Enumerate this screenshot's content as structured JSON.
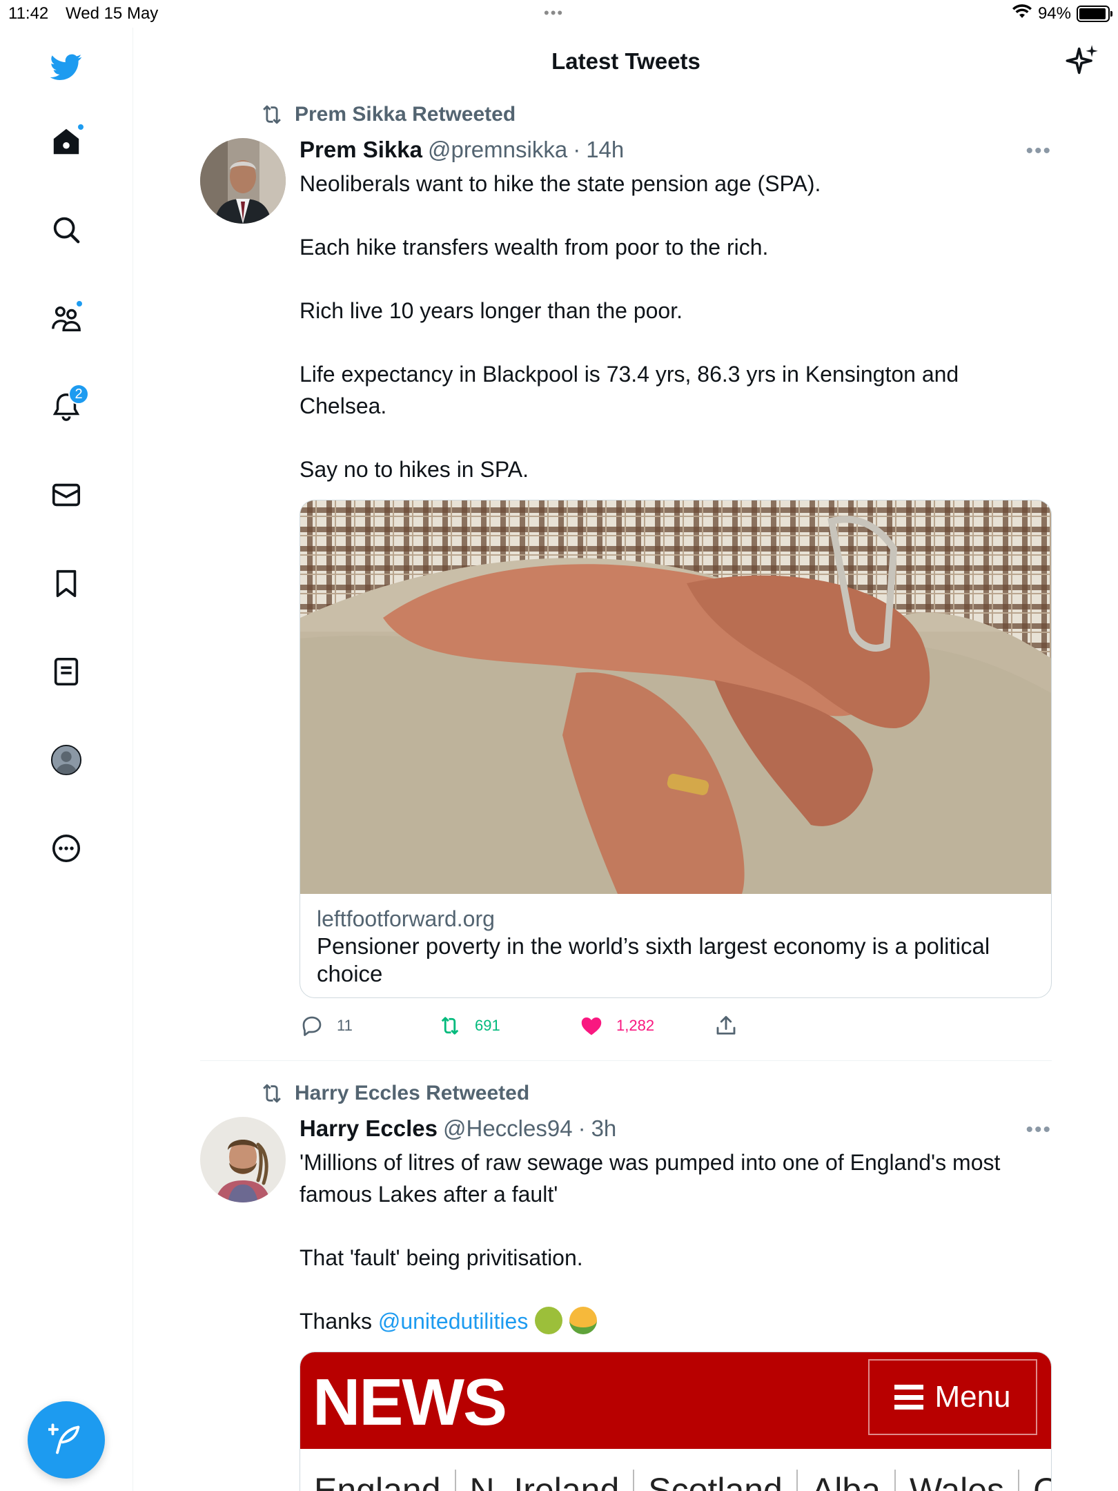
{
  "status_bar": {
    "time": "11:42",
    "date": "Wed 15 May",
    "dots": "•••",
    "battery": "94%",
    "battery_level": 0.94
  },
  "header": {
    "title": "Latest Tweets"
  },
  "sidebar": {
    "notifications_badge": "2",
    "items": [
      "twitter-logo",
      "home-icon",
      "search-icon",
      "communities-icon",
      "notifications-icon",
      "messages-icon",
      "bookmarks-icon",
      "lists-icon",
      "profile-icon",
      "more-icon"
    ]
  },
  "tweets": [
    {
      "retweeted_by": "Prem Sikka Retweeted",
      "author": "Prem Sikka",
      "handle": "@premnsikka",
      "sep": "·",
      "time": "14h",
      "more": "•••",
      "lines": [
        "Neoliberals want to hike the state pension age (SPA).",
        "",
        "Each hike transfers wealth from poor to the rich.",
        "",
        "Rich live 10 years longer than the poor.",
        "",
        "Life expectancy in Blackpool is 73.4 yrs,  86.3 yrs in Kensington and Chelsea.",
        "",
        "Say no to hikes in SPA."
      ],
      "card": {
        "domain": "leftfootforward.org",
        "title": "Pensioner poverty in the world’s sixth largest economy is a political choice"
      },
      "actions": {
        "replies": "11",
        "retweets": "691",
        "likes": "1,282"
      }
    },
    {
      "retweeted_by": "Harry Eccles Retweeted",
      "author": "Harry Eccles",
      "handle": "@Heccles94",
      "sep": "·",
      "time": "3h",
      "more": "•••",
      "lines": [
        "'Millions of litres of raw sewage was pumped into one of England's most famous Lakes after a fault'",
        "",
        "That 'fault' being privitisation.",
        ""
      ],
      "thanks_prefix": "Thanks ",
      "mention": "@unitedutilities",
      "news_card": {
        "brand": "NEWS",
        "menu": "Menu",
        "nav": [
          "England",
          "N. Ireland",
          "Scotland",
          "Alba",
          "Wales",
          "Cyr"
        ]
      }
    }
  ],
  "colors": {
    "accent": "#1d9bf0",
    "retweet_green": "#00ba7c",
    "like_pink": "#f91880",
    "secondary_text": "#536471",
    "bbc_red": "#b80000"
  }
}
